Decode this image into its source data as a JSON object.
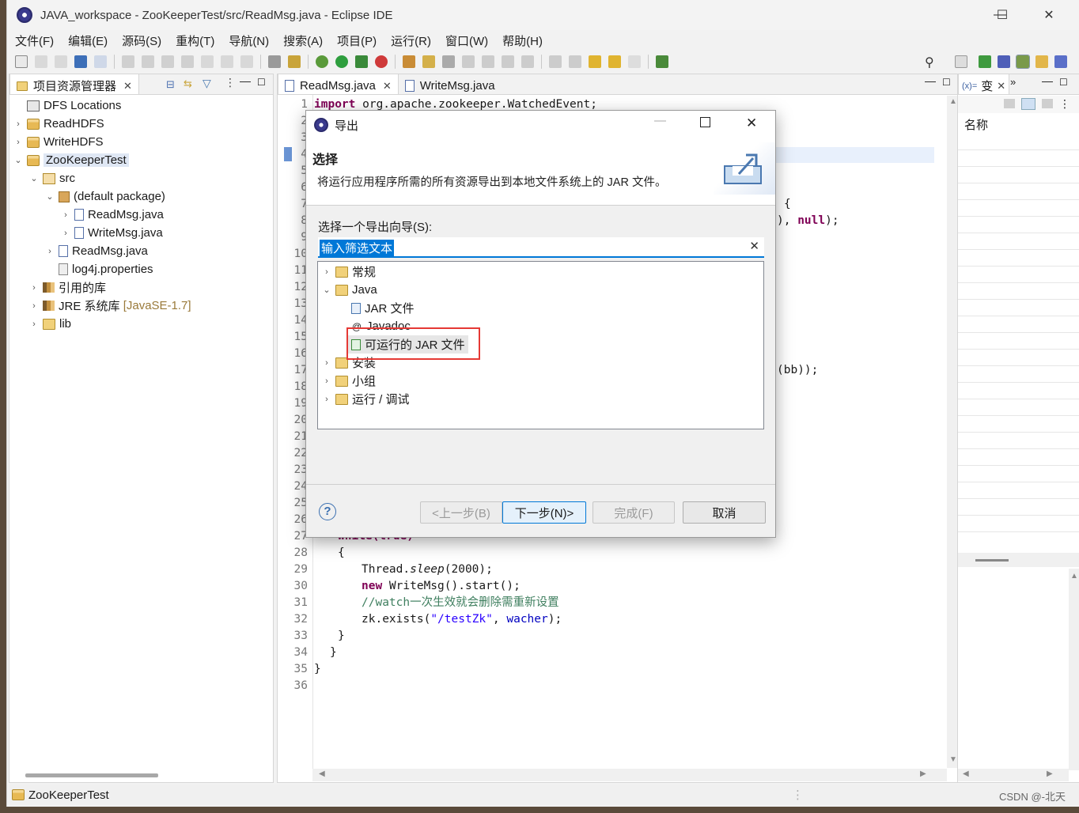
{
  "window": {
    "title": "JAVA_workspace - ZooKeeperTest/src/ReadMsg.java - Eclipse IDE",
    "minimize": "—",
    "maximize": "☐",
    "close": "✕"
  },
  "menu": [
    "文件(F)",
    "编辑(E)",
    "源码(S)",
    "重构(T)",
    "导航(N)",
    "搜索(A)",
    "项目(P)",
    "运行(R)",
    "窗口(W)",
    "帮助(H)"
  ],
  "explorer": {
    "tab_label": "项目资源管理器",
    "items": [
      {
        "label": "DFS Locations"
      },
      {
        "label": "ReadHDFS"
      },
      {
        "label": "WriteHDFS"
      },
      {
        "label": "ZooKeeperTest"
      },
      {
        "label": "src"
      },
      {
        "label": "(default package)"
      },
      {
        "label": "ReadMsg.java"
      },
      {
        "label": "WriteMsg.java"
      },
      {
        "label": "ReadMsg.java"
      },
      {
        "label": "log4j.properties"
      },
      {
        "label": "引用的库"
      },
      {
        "label": "JRE 系统库"
      },
      {
        "label": "lib"
      }
    ],
    "jre_suffix": "[JavaSE-1.7]"
  },
  "editor": {
    "tabs": [
      "ReadMsg.java",
      "WriteMsg.java"
    ],
    "line_numbers": [
      "1",
      "2",
      "3",
      "4",
      "5",
      "6",
      "7",
      "8",
      "9",
      "10",
      "11",
      "12",
      "13",
      "14",
      "15",
      "16",
      "17",
      "18",
      "19",
      "20",
      "21",
      "22",
      "23",
      "24",
      "25",
      "26",
      "27",
      "28",
      "29",
      "30",
      "31",
      "32",
      "33",
      "34",
      "35",
      "36"
    ],
    "line1_kw": "import",
    "line1_rest": " org.apache.zookeeper.WatchedEvent;",
    "line7_tail": "{",
    "line8_tail_a": "), ",
    "line8_tail_null": "null",
    "line8_tail_b": ");",
    "line17_tail": "(bb));",
    "line27": "while(true)",
    "line28": "{",
    "line29_a": "Thread.",
    "line29_b": "sleep",
    "line29_c": "(2000);",
    "line30_kw": "new",
    "line30_rest": " WriteMsg().start();",
    "line31": "//watch一次生效就会删除需重新设置",
    "line32_a": "zk.exists(",
    "line32_str": "\"/testZk\"",
    "line32_b": ", ",
    "line32_fld": "wacher",
    "line32_c": ");",
    "line33": "}",
    "line34": "}",
    "line35": "}"
  },
  "variables": {
    "tab_label": "变",
    "column": "名称"
  },
  "dialog": {
    "title": "导出",
    "header_title": "选择",
    "header_desc": "将运行应用程序所需的所有资源导出到本地文件系统上的 JAR 文件。",
    "wizard_label": "选择一个导出向导(S):",
    "filter_text": "输入筛选文本",
    "tree": [
      {
        "label": "常规"
      },
      {
        "label": "Java"
      },
      {
        "label": "JAR 文件"
      },
      {
        "label": "Javadoc"
      },
      {
        "label": "可运行的 JAR 文件"
      },
      {
        "label": "安装"
      },
      {
        "label": "小组"
      },
      {
        "label": "运行 / 调试"
      }
    ],
    "help": "?",
    "back": "<上一步(B)",
    "next": "下一步(N)>",
    "finish": "完成(F)",
    "cancel": "取消"
  },
  "status": {
    "selection": "ZooKeeperTest",
    "watermark": "CSDN @-北天"
  },
  "colors": {
    "highlight_box": "#e53935",
    "accent": "#0078d7"
  }
}
